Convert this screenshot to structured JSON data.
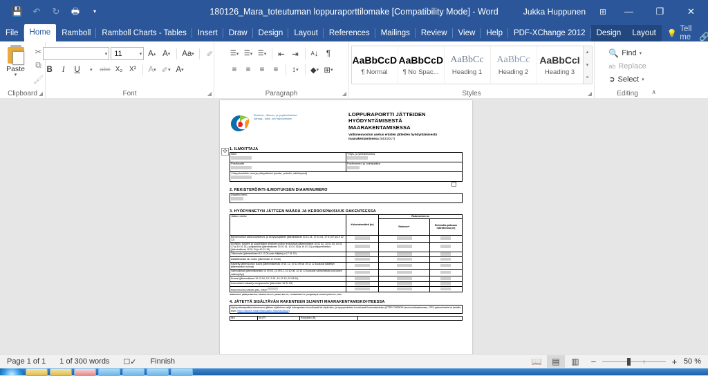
{
  "window": {
    "title": "180126_Mara_toteutuman loppuraporttilomake [Compatibility Mode]  -  Word",
    "user": "Jukka Huppunen",
    "quick_access": [
      {
        "name": "save-icon",
        "glyph": "💾"
      },
      {
        "name": "undo-icon",
        "glyph": "↶"
      },
      {
        "name": "redo-icon",
        "glyph": "↻"
      },
      {
        "name": "print-preview-icon",
        "glyph": "🖶"
      },
      {
        "name": "customize-qat-icon",
        "glyph": "▾"
      }
    ],
    "ribbon_display_options": "⊞",
    "minimize": "—",
    "restore": "❐",
    "close": "✕"
  },
  "tabs": [
    {
      "label": "File",
      "state": "file"
    },
    {
      "label": "Home",
      "state": "active"
    },
    {
      "label": "Ramboll",
      "state": "normal"
    },
    {
      "label": "Ramboll Charts - Tables",
      "state": "normal"
    },
    {
      "label": "Insert",
      "state": "normal"
    },
    {
      "label": "Draw",
      "state": "normal"
    },
    {
      "label": "Design",
      "state": "normal"
    },
    {
      "label": "Layout",
      "state": "normal"
    },
    {
      "label": "References",
      "state": "normal"
    },
    {
      "label": "Mailings",
      "state": "normal"
    },
    {
      "label": "Review",
      "state": "normal"
    },
    {
      "label": "View",
      "state": "normal"
    },
    {
      "label": "Help",
      "state": "normal"
    },
    {
      "label": "PDF-XChange 2012",
      "state": "normal"
    },
    {
      "label": "Design",
      "state": "contextual"
    },
    {
      "label": "Layout",
      "state": "contextual"
    }
  ],
  "tell_me": {
    "label": "Tell me",
    "icon": "lightbulb-icon"
  },
  "tab_right_icons": [
    {
      "name": "share-icon",
      "glyph": "🔗"
    },
    {
      "name": "comments-icon",
      "glyph": "💬"
    }
  ],
  "ribbon": {
    "clipboard": {
      "label": "Clipboard",
      "paste_label": "Paste",
      "cut": "✂",
      "copy": "⧉",
      "format_painter": "🖌"
    },
    "font": {
      "label": "Font",
      "name_value": "",
      "name_placeholder": "",
      "size_value": "11",
      "grow": "A",
      "shrink": "A",
      "change_case": "Aa",
      "clear_formatting": "✐",
      "bold": "B",
      "italic": "I",
      "underline": "U",
      "strikethrough": "abc",
      "subscript": "X₂",
      "superscript": "X²",
      "text_effects": "A",
      "highlight": "✐",
      "font_color": "A"
    },
    "paragraph": {
      "label": "Paragraph",
      "bullets": "☰",
      "numbering": "☰",
      "multilevel": "☰",
      "decrease_indent": "⇤",
      "increase_indent": "⇥",
      "sort": "↓",
      "show_marks": "¶",
      "align_left": "≡",
      "align_center": "≡",
      "align_right": "≡",
      "justify": "≡",
      "line_spacing": "↕",
      "shading": "◆",
      "borders": "⊞"
    },
    "styles": {
      "label": "Styles",
      "items": [
        {
          "preview": "AaBbCcD",
          "name": "¶ Normal"
        },
        {
          "preview": "AaBbCcD",
          "name": "¶ No Spac..."
        },
        {
          "preview": "AaBbCc",
          "name": "Heading 1"
        },
        {
          "preview": "AaBbCc",
          "name": "Heading 2"
        },
        {
          "preview": "AaBbCcI",
          "name": "Heading 3"
        }
      ],
      "scroll_up": "▴",
      "scroll_down": "▾",
      "more": "≡"
    },
    "editing": {
      "label": "Editing",
      "find": "Find",
      "replace": "Replace",
      "select": "Select",
      "collapse_ribbon": "∧"
    }
  },
  "document": {
    "logo": {
      "name": "ely-keskus-logo",
      "text_fi": "Elinkeino-, liikenne- ja ympäristökeskus",
      "text_sv": "Närings-, trafik- och miljöcentralen"
    },
    "title": "LOPPURAPORTTI JÄTTEIDEN HYÖDYNTÄMISESTÄ MAARAKENTAMISESSA",
    "subtitle": "Valtioneuvoston asetus eräiden jätteiden hyödyntämisestä maarakentamisessa",
    "subtitle_ref": "(843/2017)",
    "sections": [
      {
        "number_title": "1. ILMOITTAJA",
        "rows": [
          [
            {
              "label": "Nimi",
              "value": true
            },
            {
              "label": "Yritys- ja yhteisötunnus",
              "value": true
            }
          ],
          [
            {
              "label": "Postiosoite",
              "value": true
            },
            {
              "label": "Postinumero ja -toimipaikka",
              "value": true
            }
          ],
          [
            {
              "label": "Yhteyshenkilön nimi ja yhteystiedot (osoite, puhelin, sähköposti)",
              "value": true
            }
          ]
        ]
      },
      {
        "number_title": "2. REKISTERÖINTI-ILMOITUKSEN DIAARINUMERO",
        "rows": [
          [
            {
              "label": "Diaarinumero",
              "value": true
            }
          ]
        ]
      }
    ],
    "section3": {
      "number_title": "3. HYÖDYNNETYN JÄTTEEN MÄÄRÄ JA KERROSPAKSUUS RAKENTEESSA",
      "headers": {
        "waste": "Jätteen nimike",
        "total": "Kokonaismäärä (tn)",
        "layer_group": "Rakennekerros",
        "structure": "Rakenne*",
        "max_thickness": "Enimmäis-paksuus rakenteessa (m)"
      },
      "rows": [
        "Betonimurske sekä kevytbetoni- ja kevytsorajätteet (jätenimikkeet 10 13 14, 17 01 01, 17 01 07 ja 19 12 12)",
        "Kivihiilen, turpeen ja puuperäisen aineksen polton lentotuhkat (jätenimikkeet 10 01 02, 10 01 03, 10 01 17 ja 19 01 14), pohjatuhkat (jätenimikkeet 10 01 01, 10 01 15 ja 19 01 12) ja leijupetihiekka (jätenimikkeet 10 01 24 ja 19 01 19)",
        "Tiilimurske (jätenimikkeet 10 12 08 (vain tiilijäte) ja 17 01 02)",
        "Asfalttimurske tai -rouhe (jätenimike 17 03 02)",
        "Käsitelty jätteenpolton kuona (jätenimikkeistä 19 01 12, 19 12 09 tai 19 12 12 kuuluvat käsitellyt jätteenpolton kuonat)",
        "Valimohiekat (jätenimikkeisiin 10 09 03, 10 09 12, 10 10 06, 10 10 12 kuuluvat valimohiekat pois lukien valimopölyt)",
        "Kuonat (jätenimikkeet 10 13 04, 10 13 01, 10 12 13, 03 03 09)",
        "Kokonaiset renkaat ja rengasrouhe (jätenimike 16 01 03)",
        "Rakenteesta poistettu jäte, mikä?"
      ],
      "footnote": "*Rakenteet: päällysrakenne, kantava kerros, jakava kerros, suodatinkerros, pengertäyte, kevennyskerros, muu"
    },
    "section4": {
      "number_title": "4. JÄTETTÄ SISÄLTÄVÄN RAKENTEEN SIJAINTI MAARAKENTAMISKOHTEESSA",
      "note": "Hyödyntämispaikka toteutuneen jätteen sijoituksen neljä kulmapisteen koordinaatit tai väylä alku- ja loppupisteiden koordinaatit kokonaislukuina (ETRS-TM35FIN tasokoordinaatistossa, GPS-paikantimella tai kartalta esim.",
      "link": "https://asiointi.maanmittauslaitos.fi/karttapaikka/",
      "mini_headers": [
        "Nro",
        "Itä (P)",
        "Pohjoinen (N)"
      ]
    }
  },
  "status_bar": {
    "page": "Page 1 of 1",
    "words": "1 of 300 words",
    "proofing_icon": "proofing-errors-icon",
    "language": "Finnish",
    "views": [
      {
        "name": "read-mode-view",
        "glyph": "📖",
        "selected": false
      },
      {
        "name": "print-layout-view",
        "glyph": "▤",
        "selected": true
      },
      {
        "name": "web-layout-view",
        "glyph": "▥",
        "selected": false
      }
    ],
    "zoom_out": "−",
    "zoom_in": "+",
    "zoom_value": "50 %"
  }
}
